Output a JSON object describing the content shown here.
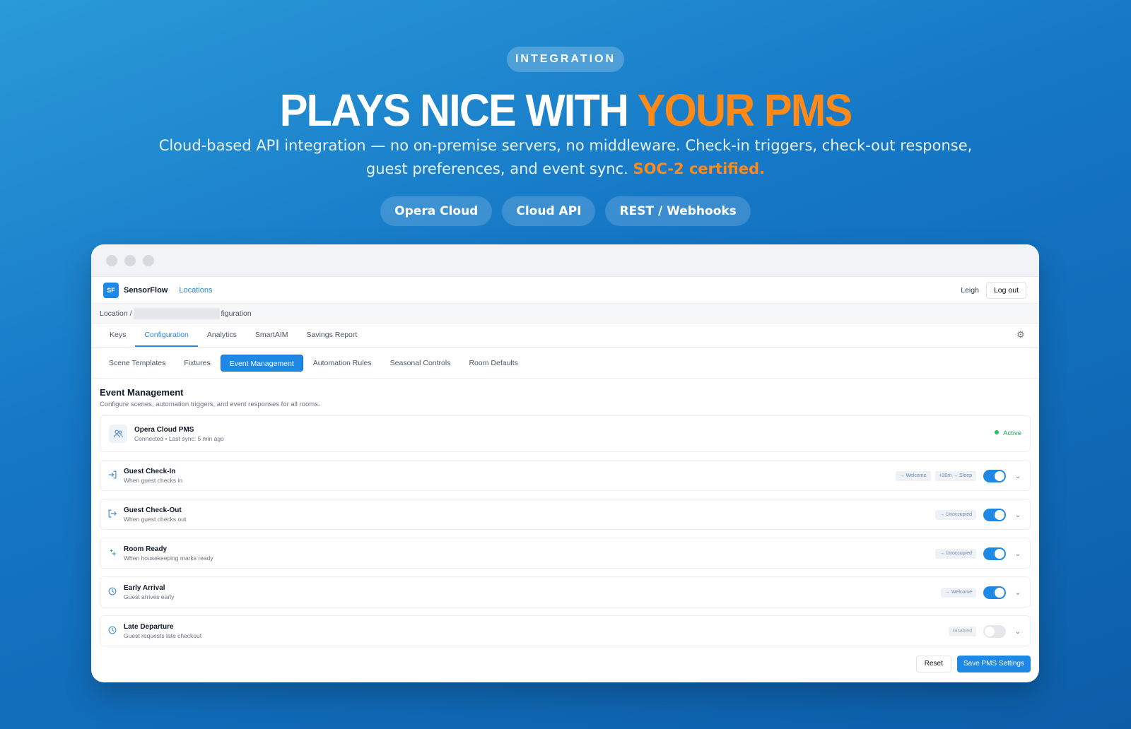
{
  "hero": {
    "tag": "INTEGRATION",
    "headline_white": "PLAYS NICE WITH ",
    "headline_accent": "YOUR PMS",
    "subtitle": "Cloud-based API integration — no on-premise servers, no middleware. Check-in triggers, check-out response, guest preferences, and event sync. ",
    "subtitle_accent": "SOC-2 certified.",
    "chips": [
      "Opera Cloud",
      "Cloud API",
      "REST / Webhooks"
    ],
    "accent_color": "#ff8a17"
  },
  "app": {
    "logo": "SF",
    "brand": "SensorFlow",
    "nav_link": "Locations",
    "user": "Leigh",
    "logout_label": "Log out",
    "breadcrumb_start": "Location /",
    "breadcrumb_end": "figuration",
    "tabs": [
      "Keys",
      "Configuration",
      "Analytics",
      "SmartAIM",
      "Savings Report"
    ],
    "active_tab": "Configuration",
    "subtabs": [
      "Scene Templates",
      "Fixtures",
      "Event Management",
      "Automation Rules",
      "Seasonal Controls",
      "Room Defaults"
    ],
    "active_subtab": "Event Management",
    "primary_color": "#1e88e5"
  },
  "section": {
    "title": "Event Management",
    "description": "Configure scenes, automation triggers, and event responses for all rooms."
  },
  "pms": {
    "name": "Opera Cloud PMS",
    "status_line": "Connected • Last sync: 5 min ago",
    "status": "Active",
    "icon": "users-icon"
  },
  "events": [
    {
      "title": "Guest Check-In",
      "subtitle": "When guest checks in",
      "icon": "sign-in-icon",
      "badges": [
        "→ Welcome",
        "+30m → Sleep"
      ],
      "enabled": true
    },
    {
      "title": "Guest Check-Out",
      "subtitle": "When guest checks out",
      "icon": "sign-out-icon",
      "badges": [
        "→ Unoccupied"
      ],
      "enabled": true
    },
    {
      "title": "Room Ready",
      "subtitle": "When housekeeping marks ready",
      "icon": "sparkle-icon",
      "badges": [
        "→ Unoccupied"
      ],
      "enabled": true
    },
    {
      "title": "Early Arrival",
      "subtitle": "Guest arrives early",
      "icon": "clock-icon",
      "badges": [
        "→ Welcome"
      ],
      "enabled": true
    },
    {
      "title": "Late Departure",
      "subtitle": "Guest requests late checkout",
      "icon": "clock-icon",
      "badges": [
        "Disabled"
      ],
      "enabled": false
    }
  ],
  "footer": {
    "reset_label": "Reset",
    "save_label": "Save PMS Settings"
  }
}
